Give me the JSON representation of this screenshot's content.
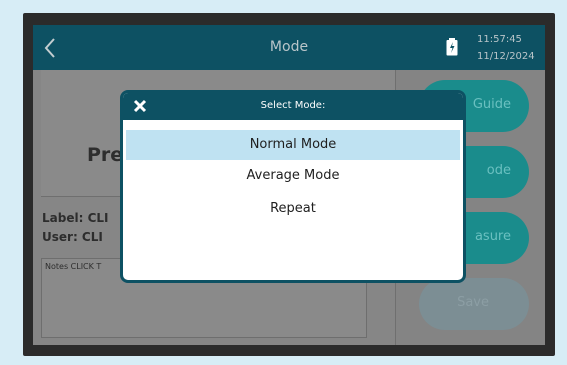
{
  "header": {
    "title": "Mode",
    "time": "11:57:45",
    "date": "11/12/2024"
  },
  "left_panel": {
    "heading_partial": "Pre",
    "label_line": "Label:  CLI",
    "user_line": "User:   CLI",
    "notes_line": "Notes CLICK T"
  },
  "side_buttons": [
    {
      "label": "Guide"
    },
    {
      "label": "ode"
    },
    {
      "label": "asure"
    },
    {
      "label": "Save"
    }
  ],
  "modal": {
    "title": "Select Mode:",
    "options": [
      {
        "label": "Normal Mode",
        "selected": true
      },
      {
        "label": "Average Mode",
        "selected": false
      },
      {
        "label": "Repeat",
        "selected": false
      }
    ]
  },
  "colors": {
    "header_bg": "#0d5163",
    "accent_teal": "#1a8c8c",
    "selected_row": "#bfe2f2"
  }
}
